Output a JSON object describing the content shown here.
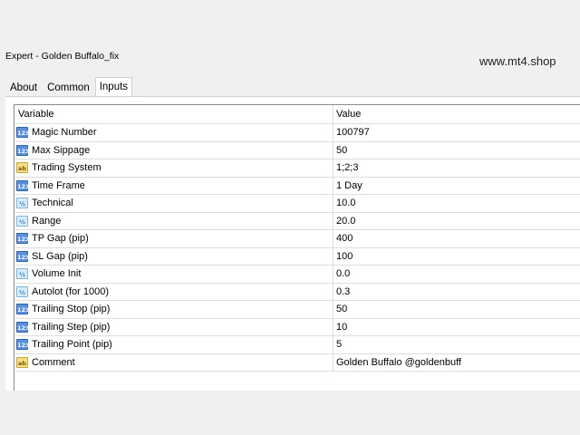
{
  "window": {
    "title": "Expert - Golden Buffalo_fix"
  },
  "watermark": "www.mt4.shop",
  "tabs": [
    {
      "label": "About",
      "active": false
    },
    {
      "label": "Common",
      "active": false
    },
    {
      "label": "Inputs",
      "active": true
    }
  ],
  "table": {
    "headers": {
      "variable": "Variable",
      "value": "Value"
    },
    "rows": [
      {
        "icon": "integer-icon",
        "variable": "Magic Number",
        "value": "100797"
      },
      {
        "icon": "integer-icon",
        "variable": "Max Sippage",
        "value": "50"
      },
      {
        "icon": "string-icon",
        "variable": "Trading System",
        "value": "1;2;3"
      },
      {
        "icon": "integer-icon",
        "variable": "Time Frame",
        "value": "1 Day"
      },
      {
        "icon": "double-icon",
        "variable": "Technical",
        "value": "10.0"
      },
      {
        "icon": "double-icon",
        "variable": "Range",
        "value": "20.0"
      },
      {
        "icon": "integer-icon",
        "variable": "TP Gap (pip)",
        "value": "400"
      },
      {
        "icon": "integer-icon",
        "variable": "SL Gap (pip)",
        "value": "100"
      },
      {
        "icon": "double-icon",
        "variable": "Volume Init",
        "value": "0.0"
      },
      {
        "icon": "double-icon",
        "variable": "Autolot (for 1000)",
        "value": "0.3"
      },
      {
        "icon": "integer-icon",
        "variable": "Trailing Stop (pip)",
        "value": "50"
      },
      {
        "icon": "integer-icon",
        "variable": "Trailing Step (pip)",
        "value": "10"
      },
      {
        "icon": "integer-icon",
        "variable": "Trailing Point (pip)",
        "value": "5"
      },
      {
        "icon": "string-icon",
        "variable": "Comment",
        "value": "Golden Buffalo @goldenbuff"
      }
    ]
  }
}
